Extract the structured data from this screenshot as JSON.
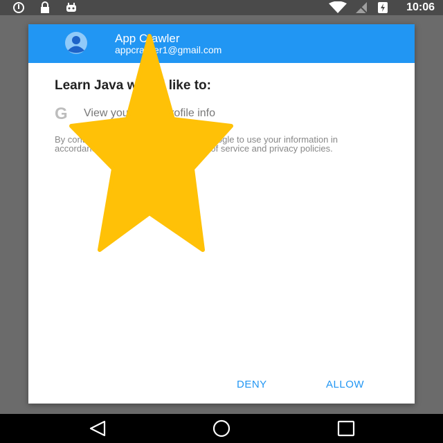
{
  "status_bar": {
    "time": "10:06",
    "left_icons": [
      "sync-icon",
      "lock-icon",
      "android-icon"
    ],
    "right_icons": [
      "wifi-icon",
      "signal-icon",
      "battery-icon"
    ]
  },
  "dialog": {
    "account_name": "App Crawler",
    "account_email": "appcrawler1@gmail.com",
    "request_title": "Learn Java would like to:",
    "permission": "View your basic profile info",
    "consent_text": "By continuing, you allow this app and Google to use your information in accordance with their respective terms of service and privacy policies.",
    "deny_label": "DENY",
    "allow_label": "ALLOW"
  },
  "overlay": {
    "icon": "star-icon",
    "color": "#ffc107"
  },
  "nav_bar": {
    "buttons": [
      "back-icon",
      "home-icon",
      "recents-icon"
    ]
  },
  "colors": {
    "accent": "#2196f3",
    "header_text": "#ffffff"
  }
}
